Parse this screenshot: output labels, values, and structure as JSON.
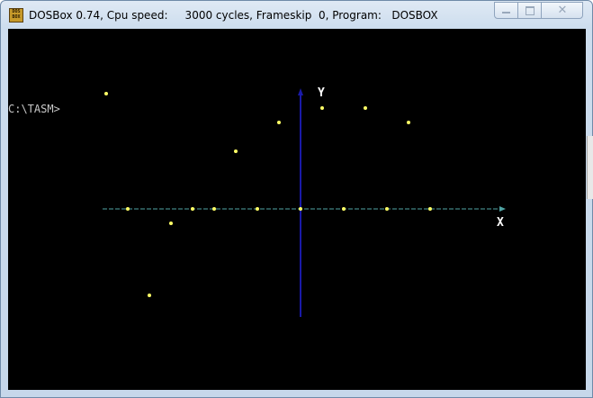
{
  "window": {
    "title": "DOSBox 0.74, Cpu speed:     3000 cycles, Frameskip  0, Program:   DOSBOX",
    "icon_text_top": "DOS",
    "icon_text_bottom": "BOX",
    "controls": {
      "minimize": "minimize-icon",
      "maximize": "maximize-icon",
      "close": "close-icon"
    }
  },
  "console": {
    "prompt": "C:\\TASM>"
  },
  "plot": {
    "x_axis_label": "X",
    "y_axis_label": "Y",
    "colors": {
      "background": "#000000",
      "x_axis": "#4fa3a3",
      "y_axis": "#1a1aa8",
      "points": "#ffff66",
      "text": "#c8c8c8"
    }
  }
}
